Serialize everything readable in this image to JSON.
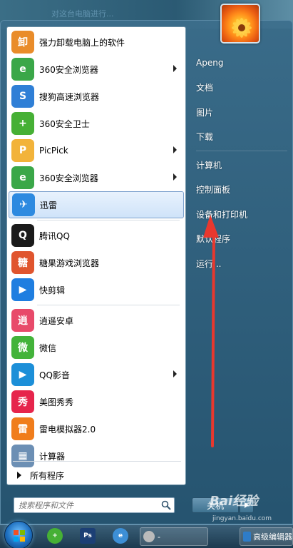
{
  "desktop": {
    "text": "对这台电脑进行..."
  },
  "programs": [
    {
      "label": "强力卸载电脑上的软件",
      "icon": "uninstall-icon",
      "color": "#e98c2a",
      "glyph": "卸",
      "submenu": false
    },
    {
      "label": "360安全浏览器",
      "icon": "360-browser-icon",
      "color": "#3aa748",
      "glyph": "e",
      "submenu": true
    },
    {
      "label": "搜狗高速浏览器",
      "icon": "sogou-browser-icon",
      "color": "#2f7fd6",
      "glyph": "S",
      "submenu": false
    },
    {
      "label": "360安全卫士",
      "icon": "360-safe-icon",
      "color": "#46b035",
      "glyph": "+",
      "submenu": false
    },
    {
      "label": "PicPick",
      "icon": "picpick-icon",
      "color": "#f2b33a",
      "glyph": "P",
      "submenu": true
    },
    {
      "label": "360安全浏览器",
      "icon": "360-browser-icon",
      "color": "#3aa748",
      "glyph": "e",
      "submenu": true
    },
    {
      "label": "迅雷",
      "icon": "xunlei-icon",
      "color": "#2d8ae0",
      "glyph": "✈",
      "submenu": false,
      "selected": true
    },
    {
      "label": "腾讯QQ",
      "icon": "qq-icon",
      "color": "#1a1a1a",
      "glyph": "Q",
      "submenu": false
    },
    {
      "label": "糖果游戏浏览器",
      "icon": "candy-browser-icon",
      "color": "#e0552e",
      "glyph": "糖",
      "submenu": false
    },
    {
      "label": "快剪辑",
      "icon": "kuaijianji-icon",
      "color": "#1f7ee0",
      "glyph": "▶",
      "submenu": false
    },
    {
      "label": "逍遥安卓",
      "icon": "xiaoyao-icon",
      "color": "#e84a6a",
      "glyph": "逍",
      "submenu": false
    },
    {
      "label": "微信",
      "icon": "wechat-icon",
      "color": "#43b33a",
      "glyph": "微",
      "submenu": false
    },
    {
      "label": "QQ影音",
      "icon": "qqplayer-icon",
      "color": "#1c8fd8",
      "glyph": "▶",
      "submenu": true
    },
    {
      "label": "美图秀秀",
      "icon": "meitu-icon",
      "color": "#e6254c",
      "glyph": "秀",
      "submenu": false
    },
    {
      "label": "雷电模拟器2.0",
      "icon": "leidian-icon",
      "color": "#f07d1c",
      "glyph": "雷",
      "submenu": false
    },
    {
      "label": "计算器",
      "icon": "calculator-icon",
      "color": "#6c8fb4",
      "glyph": "▦",
      "submenu": false
    }
  ],
  "all_programs": "所有程序",
  "search": {
    "placeholder": "搜索程序和文件"
  },
  "right_items": [
    "Apeng",
    "文档",
    "图片",
    "下载",
    "计算机",
    "控制面板",
    "设备和打印机",
    "默认程序",
    "运行..."
  ],
  "shutdown": {
    "label": "关机"
  },
  "taskbar": {
    "window1": "-",
    "window2": "高级编辑器"
  },
  "watermark": {
    "main": "Bai经验",
    "sub": "jingyan.baidu.com"
  }
}
